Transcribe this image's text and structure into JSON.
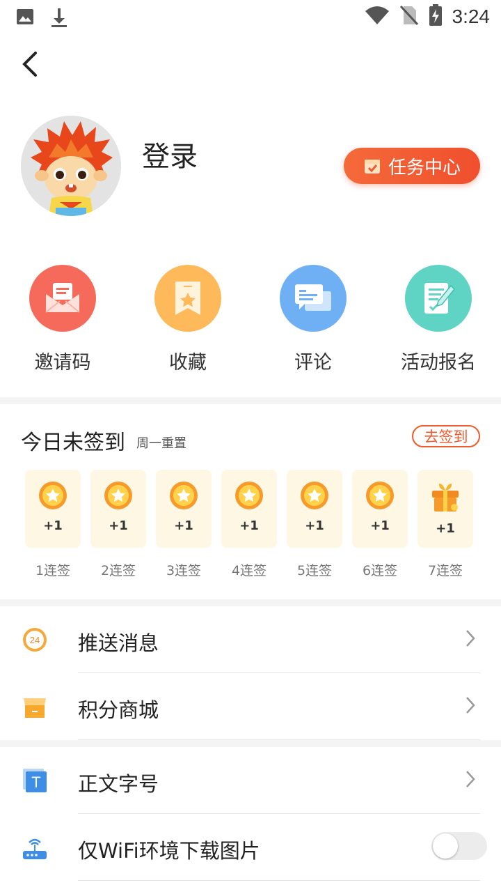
{
  "status_bar": {
    "time": "3:24",
    "icons": [
      "image-icon",
      "download-icon",
      "wifi-icon",
      "no-sim-icon",
      "battery-charging-icon"
    ]
  },
  "header": {
    "back_icon": "back-arrow-icon"
  },
  "profile": {
    "login_label": "登录",
    "task_center_label": "任务中心"
  },
  "quick_actions": [
    {
      "label": "邀请码",
      "icon": "invite-mail-icon",
      "color": "#f56a5a"
    },
    {
      "label": "收藏",
      "icon": "bookmark-star-icon",
      "color": "#fdb95a"
    },
    {
      "label": "评论",
      "icon": "comment-icon",
      "color": "#6fb0f5"
    },
    {
      "label": "活动报名",
      "icon": "signup-form-icon",
      "color": "#5fd4c4"
    }
  ],
  "signin": {
    "title": "今日未签到",
    "subtitle": "周一重置",
    "button": "去签到",
    "days": [
      {
        "reward": "+1",
        "label": "1连签",
        "icon": "coin-icon"
      },
      {
        "reward": "+1",
        "label": "2连签",
        "icon": "coin-icon"
      },
      {
        "reward": "+1",
        "label": "3连签",
        "icon": "coin-icon"
      },
      {
        "reward": "+1",
        "label": "4连签",
        "icon": "coin-icon"
      },
      {
        "reward": "+1",
        "label": "5连签",
        "icon": "coin-icon"
      },
      {
        "reward": "+1",
        "label": "6连签",
        "icon": "coin-icon"
      },
      {
        "reward": "+1",
        "label": "7连签",
        "icon": "gift-box-icon"
      }
    ]
  },
  "settings": {
    "push": {
      "label": "推送消息",
      "icon": "clock-24-icon",
      "badge": "24"
    },
    "mall": {
      "label": "积分商城",
      "icon": "shop-icon"
    },
    "font_size": {
      "label": "正文字号",
      "icon": "text-size-icon",
      "badge": "T"
    },
    "wifi_download": {
      "label": "仅WiFi环境下载图片",
      "icon": "router-icon",
      "enabled": false
    }
  },
  "colors": {
    "accent": "#f05a2d",
    "card_bg": "#fdf7e4",
    "divider": "#f4f4f4"
  }
}
